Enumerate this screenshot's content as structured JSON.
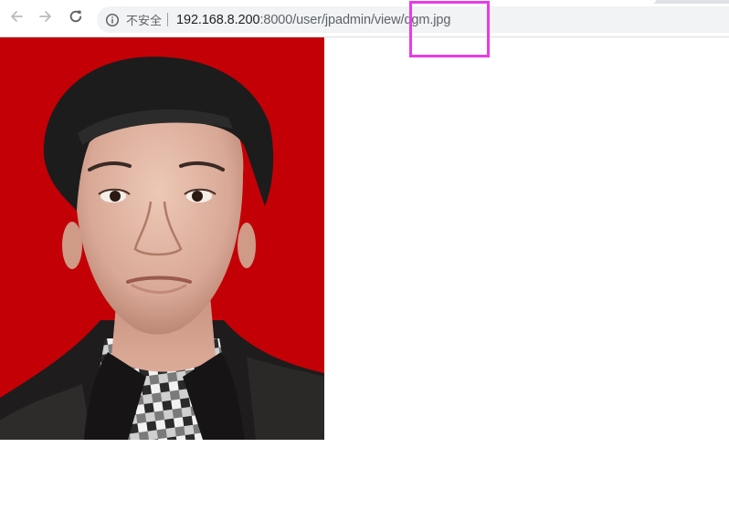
{
  "browser": {
    "security_label": "不安全",
    "url_host": "192.168.8.200",
    "url_path": ":8000/user/jpadmin/view/dgm.jpg",
    "icons": {
      "back": "arrow-left-icon",
      "forward": "arrow-right-icon",
      "reload": "reload-icon",
      "info": "info-circle-icon"
    }
  },
  "annotation": {
    "color": "#e83be8"
  },
  "photo": {
    "background_color": "#c30006"
  }
}
